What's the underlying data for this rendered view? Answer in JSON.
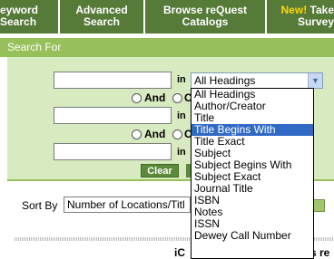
{
  "nav": {
    "tabs": [
      {
        "line1": "eyword",
        "line2": "Search"
      },
      {
        "line1": "Advanced",
        "line2": "Search"
      },
      {
        "line1": "Browse reQuest",
        "line2": "Catalogs"
      },
      {
        "new_badge": "New!",
        "line1": "Take",
        "line2": "Survey"
      }
    ]
  },
  "search": {
    "heading": "Search For",
    "in_label": "in",
    "and_label": "And",
    "field_selected": "All Headings",
    "clear_label": "Clear",
    "row2_in": "in",
    "row3_in": "in",
    "cut_radio_char": "C"
  },
  "dropdown": {
    "options": [
      "All Headings",
      "Author/Creator",
      "Title",
      "Title Begins With",
      "Title Exact",
      "Subject",
      "Subject Begins With",
      "Subject Exact",
      "Journal Title",
      "ISBN",
      "Notes",
      "ISSN",
      "Dewey Call Number"
    ],
    "highlighted": "Title Begins With"
  },
  "sort": {
    "label": "Sort By",
    "value": "Number of Locations/Titl"
  },
  "footer": {
    "left_text": "iC",
    "right_text": "s re"
  },
  "colors": {
    "nav_tab": "#567a38",
    "panel_head": "#98c05a",
    "panel_bg": "#d8ebc0",
    "highlight": "#316ac5",
    "new_badge": "#ffd700"
  }
}
